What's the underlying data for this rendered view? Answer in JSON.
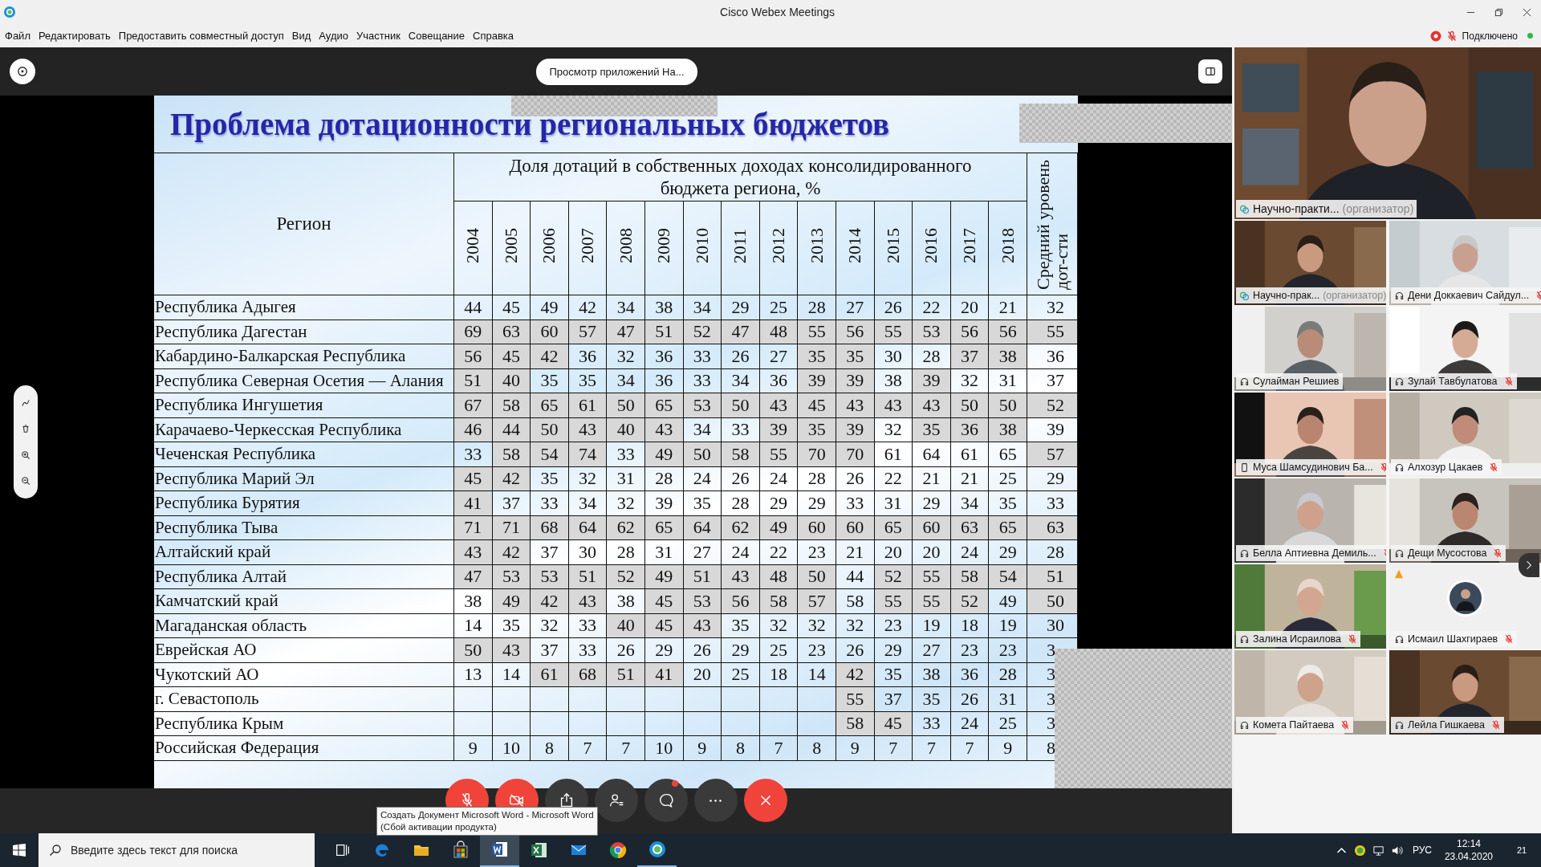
{
  "window": {
    "title": "Cisco Webex Meetings"
  },
  "menu": [
    "Файл",
    "Редактировать",
    "Предоставить совместный доступ",
    "Вид",
    "Аудио",
    "Участник",
    "Совещание",
    "Справка"
  ],
  "connection": {
    "label": "Подключено"
  },
  "share_bar": {
    "label": "Просмотр приложений На..."
  },
  "slide": {
    "title": "Проблема дотационности региональных бюджетов",
    "table": {
      "region_header": "Регион",
      "group_header": "Доля дотаций в собственных доходах консолидированного бюджета региона, %",
      "years": [
        "2004",
        "2005",
        "2006",
        "2007",
        "2008",
        "2009",
        "2010",
        "2011",
        "2012",
        "2013",
        "2014",
        "2015",
        "2016",
        "2017",
        "2018"
      ],
      "average_header": "Средний уровень дот-сти",
      "rows": [
        {
          "region": "Республика Адыгея",
          "cells": [
            {
              "value": "44",
              "shaded": false
            },
            {
              "value": "45",
              "shaded": false
            },
            {
              "value": "49",
              "shaded": false
            },
            {
              "value": "42",
              "shaded": false
            },
            {
              "value": "34",
              "shaded": false
            },
            {
              "value": "38",
              "shaded": false
            },
            {
              "value": "34",
              "shaded": false
            },
            {
              "value": "29",
              "shaded": false
            },
            {
              "value": "25",
              "shaded": false
            },
            {
              "value": "28",
              "shaded": false
            },
            {
              "value": "27",
              "shaded": false
            },
            {
              "value": "26",
              "shaded": false
            },
            {
              "value": "22",
              "shaded": false
            },
            {
              "value": "20",
              "shaded": false
            },
            {
              "value": "21",
              "shaded": false
            },
            {
              "value": "32",
              "shaded": false
            }
          ]
        },
        {
          "region": "Республика Дагестан",
          "cells": [
            {
              "value": "69",
              "shaded": true
            },
            {
              "value": "63",
              "shaded": true
            },
            {
              "value": "60",
              "shaded": true
            },
            {
              "value": "57",
              "shaded": true
            },
            {
              "value": "47",
              "shaded": true
            },
            {
              "value": "51",
              "shaded": true
            },
            {
              "value": "52",
              "shaded": true
            },
            {
              "value": "47",
              "shaded": true
            },
            {
              "value": "48",
              "shaded": true
            },
            {
              "value": "55",
              "shaded": true
            },
            {
              "value": "56",
              "shaded": true
            },
            {
              "value": "55",
              "shaded": true
            },
            {
              "value": "53",
              "shaded": true
            },
            {
              "value": "56",
              "shaded": true
            },
            {
              "value": "56",
              "shaded": true
            },
            {
              "value": "55",
              "shaded": true
            }
          ]
        },
        {
          "region": "Кабардино-Балкарская Республика",
          "cells": [
            {
              "value": "56",
              "shaded": true
            },
            {
              "value": "45",
              "shaded": true
            },
            {
              "value": "42",
              "shaded": true
            },
            {
              "value": "36",
              "shaded": false
            },
            {
              "value": "32",
              "shaded": false
            },
            {
              "value": "36",
              "shaded": false
            },
            {
              "value": "33",
              "shaded": false
            },
            {
              "value": "26",
              "shaded": false
            },
            {
              "value": "27",
              "shaded": false
            },
            {
              "value": "35",
              "shaded": true
            },
            {
              "value": "35",
              "shaded": true
            },
            {
              "value": "30",
              "shaded": false
            },
            {
              "value": "28",
              "shaded": false
            },
            {
              "value": "37",
              "shaded": true
            },
            {
              "value": "38",
              "shaded": true
            },
            {
              "value": "36",
              "shaded": false
            }
          ]
        },
        {
          "region": "Республика Северная Осетия — Алания",
          "cells": [
            {
              "value": "51",
              "shaded": true
            },
            {
              "value": "40",
              "shaded": true
            },
            {
              "value": "35",
              "shaded": false
            },
            {
              "value": "35",
              "shaded": false
            },
            {
              "value": "34",
              "shaded": false
            },
            {
              "value": "36",
              "shaded": false
            },
            {
              "value": "33",
              "shaded": false
            },
            {
              "value": "34",
              "shaded": false
            },
            {
              "value": "36",
              "shaded": false
            },
            {
              "value": "39",
              "shaded": true
            },
            {
              "value": "39",
              "shaded": true
            },
            {
              "value": "38",
              "shaded": false
            },
            {
              "value": "39",
              "shaded": true
            },
            {
              "value": "32",
              "shaded": false
            },
            {
              "value": "31",
              "shaded": false
            },
            {
              "value": "37",
              "shaded": false
            }
          ]
        },
        {
          "region": "Республика Ингушетия",
          "cells": [
            {
              "value": "67",
              "shaded": true
            },
            {
              "value": "58",
              "shaded": true
            },
            {
              "value": "65",
              "shaded": true
            },
            {
              "value": "61",
              "shaded": true
            },
            {
              "value": "50",
              "shaded": true
            },
            {
              "value": "65",
              "shaded": true
            },
            {
              "value": "53",
              "shaded": true
            },
            {
              "value": "50",
              "shaded": true
            },
            {
              "value": "43",
              "shaded": true
            },
            {
              "value": "45",
              "shaded": true
            },
            {
              "value": "43",
              "shaded": true
            },
            {
              "value": "43",
              "shaded": true
            },
            {
              "value": "43",
              "shaded": true
            },
            {
              "value": "50",
              "shaded": true
            },
            {
              "value": "50",
              "shaded": true
            },
            {
              "value": "52",
              "shaded": true
            }
          ]
        },
        {
          "region": "Карачаево-Черкесская Республика",
          "cells": [
            {
              "value": "46",
              "shaded": true
            },
            {
              "value": "44",
              "shaded": true
            },
            {
              "value": "50",
              "shaded": true
            },
            {
              "value": "43",
              "shaded": true
            },
            {
              "value": "40",
              "shaded": true
            },
            {
              "value": "43",
              "shaded": true
            },
            {
              "value": "34",
              "shaded": false
            },
            {
              "value": "33",
              "shaded": false
            },
            {
              "value": "39",
              "shaded": true
            },
            {
              "value": "35",
              "shaded": true
            },
            {
              "value": "39",
              "shaded": true
            },
            {
              "value": "32",
              "shaded": false
            },
            {
              "value": "35",
              "shaded": true
            },
            {
              "value": "36",
              "shaded": true
            },
            {
              "value": "38",
              "shaded": true
            },
            {
              "value": "39",
              "shaded": false
            }
          ]
        },
        {
          "region": "Чеченская Республика",
          "cells": [
            {
              "value": "33",
              "shaded": false
            },
            {
              "value": "58",
              "shaded": true
            },
            {
              "value": "54",
              "shaded": true
            },
            {
              "value": "74",
              "shaded": true
            },
            {
              "value": "33",
              "shaded": false
            },
            {
              "value": "49",
              "shaded": true
            },
            {
              "value": "50",
              "shaded": true
            },
            {
              "value": "58",
              "shaded": true
            },
            {
              "value": "55",
              "shaded": true
            },
            {
              "value": "70",
              "shaded": true
            },
            {
              "value": "70",
              "shaded": true
            },
            {
              "value": "61",
              "shaded": false
            },
            {
              "value": "64",
              "shaded": false
            },
            {
              "value": "61",
              "shaded": false
            },
            {
              "value": "65",
              "shaded": false
            },
            {
              "value": "57",
              "shaded": true
            }
          ]
        },
        {
          "region": "Республика Марий Эл",
          "cells": [
            {
              "value": "45",
              "shaded": true
            },
            {
              "value": "42",
              "shaded": true
            },
            {
              "value": "35",
              "shaded": false
            },
            {
              "value": "32",
              "shaded": false
            },
            {
              "value": "31",
              "shaded": false
            },
            {
              "value": "28",
              "shaded": false
            },
            {
              "value": "24",
              "shaded": false
            },
            {
              "value": "26",
              "shaded": false
            },
            {
              "value": "24",
              "shaded": false
            },
            {
              "value": "28",
              "shaded": false
            },
            {
              "value": "26",
              "shaded": false
            },
            {
              "value": "22",
              "shaded": false
            },
            {
              "value": "21",
              "shaded": false
            },
            {
              "value": "21",
              "shaded": false
            },
            {
              "value": "25",
              "shaded": false
            },
            {
              "value": "29",
              "shaded": false
            }
          ]
        },
        {
          "region": "Республика Бурятия",
          "cells": [
            {
              "value": "41",
              "shaded": true
            },
            {
              "value": "37",
              "shaded": false
            },
            {
              "value": "33",
              "shaded": false
            },
            {
              "value": "34",
              "shaded": false
            },
            {
              "value": "32",
              "shaded": false
            },
            {
              "value": "39",
              "shaded": false
            },
            {
              "value": "35",
              "shaded": false
            },
            {
              "value": "28",
              "shaded": false
            },
            {
              "value": "29",
              "shaded": false
            },
            {
              "value": "29",
              "shaded": false
            },
            {
              "value": "33",
              "shaded": false
            },
            {
              "value": "31",
              "shaded": false
            },
            {
              "value": "29",
              "shaded": false
            },
            {
              "value": "34",
              "shaded": false
            },
            {
              "value": "35",
              "shaded": false
            },
            {
              "value": "33",
              "shaded": false
            }
          ]
        },
        {
          "region": "Республика Тыва",
          "cells": [
            {
              "value": "71",
              "shaded": true
            },
            {
              "value": "71",
              "shaded": true
            },
            {
              "value": "68",
              "shaded": true
            },
            {
              "value": "64",
              "shaded": true
            },
            {
              "value": "62",
              "shaded": true
            },
            {
              "value": "65",
              "shaded": true
            },
            {
              "value": "64",
              "shaded": true
            },
            {
              "value": "62",
              "shaded": true
            },
            {
              "value": "49",
              "shaded": true
            },
            {
              "value": "60",
              "shaded": true
            },
            {
              "value": "60",
              "shaded": true
            },
            {
              "value": "65",
              "shaded": true
            },
            {
              "value": "60",
              "shaded": true
            },
            {
              "value": "63",
              "shaded": true
            },
            {
              "value": "65",
              "shaded": true
            },
            {
              "value": "63",
              "shaded": true
            }
          ]
        },
        {
          "region": "Алтайский край",
          "cells": [
            {
              "value": "43",
              "shaded": true
            },
            {
              "value": "42",
              "shaded": true
            },
            {
              "value": "37",
              "shaded": false
            },
            {
              "value": "30",
              "shaded": false
            },
            {
              "value": "28",
              "shaded": false
            },
            {
              "value": "31",
              "shaded": false
            },
            {
              "value": "27",
              "shaded": false
            },
            {
              "value": "24",
              "shaded": false
            },
            {
              "value": "22",
              "shaded": false
            },
            {
              "value": "23",
              "shaded": false
            },
            {
              "value": "21",
              "shaded": false
            },
            {
              "value": "20",
              "shaded": false
            },
            {
              "value": "20",
              "shaded": false
            },
            {
              "value": "24",
              "shaded": false
            },
            {
              "value": "29",
              "shaded": false
            },
            {
              "value": "28",
              "shaded": false
            }
          ]
        },
        {
          "region": "Республика Алтай",
          "cells": [
            {
              "value": "47",
              "shaded": true
            },
            {
              "value": "53",
              "shaded": true
            },
            {
              "value": "53",
              "shaded": true
            },
            {
              "value": "51",
              "shaded": true
            },
            {
              "value": "52",
              "shaded": true
            },
            {
              "value": "49",
              "shaded": true
            },
            {
              "value": "51",
              "shaded": true
            },
            {
              "value": "43",
              "shaded": true
            },
            {
              "value": "48",
              "shaded": true
            },
            {
              "value": "50",
              "shaded": true
            },
            {
              "value": "44",
              "shaded": false
            },
            {
              "value": "52",
              "shaded": true
            },
            {
              "value": "55",
              "shaded": true
            },
            {
              "value": "58",
              "shaded": true
            },
            {
              "value": "54",
              "shaded": true
            },
            {
              "value": "51",
              "shaded": true
            }
          ]
        },
        {
          "region": "Камчатский край",
          "cells": [
            {
              "value": "38",
              "shaded": false
            },
            {
              "value": "49",
              "shaded": true
            },
            {
              "value": "42",
              "shaded": true
            },
            {
              "value": "43",
              "shaded": true
            },
            {
              "value": "38",
              "shaded": false
            },
            {
              "value": "45",
              "shaded": true
            },
            {
              "value": "53",
              "shaded": true
            },
            {
              "value": "56",
              "shaded": true
            },
            {
              "value": "58",
              "shaded": true
            },
            {
              "value": "57",
              "shaded": true
            },
            {
              "value": "58",
              "shaded": false
            },
            {
              "value": "55",
              "shaded": true
            },
            {
              "value": "55",
              "shaded": true
            },
            {
              "value": "52",
              "shaded": true
            },
            {
              "value": "49",
              "shaded": false
            },
            {
              "value": "50",
              "shaded": true
            }
          ]
        },
        {
          "region": "Магаданская область",
          "cells": [
            {
              "value": "14",
              "shaded": false
            },
            {
              "value": "35",
              "shaded": false
            },
            {
              "value": "32",
              "shaded": false
            },
            {
              "value": "33",
              "shaded": false
            },
            {
              "value": "40",
              "shaded": true
            },
            {
              "value": "45",
              "shaded": true
            },
            {
              "value": "43",
              "shaded": true
            },
            {
              "value": "35",
              "shaded": false
            },
            {
              "value": "32",
              "shaded": false
            },
            {
              "value": "32",
              "shaded": false
            },
            {
              "value": "32",
              "shaded": false
            },
            {
              "value": "23",
              "shaded": false
            },
            {
              "value": "19",
              "shaded": false
            },
            {
              "value": "18",
              "shaded": false
            },
            {
              "value": "19",
              "shaded": false
            },
            {
              "value": "30",
              "shaded": false
            }
          ]
        },
        {
          "region": "Еврейская АО",
          "cells": [
            {
              "value": "50",
              "shaded": true
            },
            {
              "value": "43",
              "shaded": true
            },
            {
              "value": "37",
              "shaded": false
            },
            {
              "value": "33",
              "shaded": false
            },
            {
              "value": "26",
              "shaded": false
            },
            {
              "value": "29",
              "shaded": false
            },
            {
              "value": "26",
              "shaded": false
            },
            {
              "value": "29",
              "shaded": false
            },
            {
              "value": "25",
              "shaded": false
            },
            {
              "value": "23",
              "shaded": false
            },
            {
              "value": "26",
              "shaded": false
            },
            {
              "value": "29",
              "shaded": false
            },
            {
              "value": "27",
              "shaded": false
            },
            {
              "value": "23",
              "shaded": false
            },
            {
              "value": "23",
              "shaded": false
            },
            {
              "value": "3",
              "shaded": false
            }
          ]
        },
        {
          "region": "Чукотский АО",
          "cells": [
            {
              "value": "13",
              "shaded": false
            },
            {
              "value": "14",
              "shaded": false
            },
            {
              "value": "61",
              "shaded": true
            },
            {
              "value": "68",
              "shaded": true
            },
            {
              "value": "51",
              "shaded": true
            },
            {
              "value": "41",
              "shaded": true
            },
            {
              "value": "20",
              "shaded": false
            },
            {
              "value": "25",
              "shaded": false
            },
            {
              "value": "18",
              "shaded": false
            },
            {
              "value": "14",
              "shaded": false
            },
            {
              "value": "42",
              "shaded": true
            },
            {
              "value": "35",
              "shaded": false
            },
            {
              "value": "38",
              "shaded": false
            },
            {
              "value": "36",
              "shaded": false
            },
            {
              "value": "28",
              "shaded": false
            },
            {
              "value": "3",
              "shaded": false
            }
          ]
        },
        {
          "region": "г. Севастополь",
          "cells": [
            {
              "shaded": false
            },
            {
              "shaded": false
            },
            {
              "shaded": false
            },
            {
              "shaded": false
            },
            {
              "shaded": false
            },
            {
              "shaded": false
            },
            {
              "shaded": false
            },
            {
              "shaded": false
            },
            {
              "shaded": false
            },
            {
              "shaded": false
            },
            {
              "value": "55",
              "shaded": true
            },
            {
              "value": "37",
              "shaded": false
            },
            {
              "value": "35",
              "shaded": false
            },
            {
              "value": "26",
              "shaded": false
            },
            {
              "value": "31",
              "shaded": false
            },
            {
              "value": "3",
              "shaded": false
            }
          ]
        },
        {
          "region": "Республика Крым",
          "cells": [
            {
              "shaded": false
            },
            {
              "shaded": false
            },
            {
              "shaded": false
            },
            {
              "shaded": false
            },
            {
              "shaded": false
            },
            {
              "shaded": false
            },
            {
              "shaded": false
            },
            {
              "shaded": false
            },
            {
              "shaded": false
            },
            {
              "shaded": false
            },
            {
              "value": "58",
              "shaded": true
            },
            {
              "value": "45",
              "shaded": true
            },
            {
              "value": "33",
              "shaded": false
            },
            {
              "value": "24",
              "shaded": false
            },
            {
              "value": "25",
              "shaded": false
            },
            {
              "value": "3",
              "shaded": false
            }
          ]
        },
        {
          "region": "Российская Федерация",
          "cells": [
            {
              "value": "9",
              "shaded": false
            },
            {
              "value": "10",
              "shaded": false
            },
            {
              "value": "8",
              "shaded": false
            },
            {
              "value": "7",
              "shaded": false
            },
            {
              "value": "7",
              "shaded": false
            },
            {
              "value": "10",
              "shaded": false
            },
            {
              "value": "9",
              "shaded": false
            },
            {
              "value": "8",
              "shaded": false
            },
            {
              "value": "7",
              "shaded": false
            },
            {
              "value": "8",
              "shaded": false
            },
            {
              "value": "9",
              "shaded": false
            },
            {
              "value": "7",
              "shaded": false
            },
            {
              "value": "7",
              "shaded": false
            },
            {
              "value": "7",
              "shaded": false
            },
            {
              "value": "9",
              "shaded": false
            },
            {
              "value": "8",
              "shaded": false
            }
          ]
        }
      ]
    }
  },
  "participants": {
    "main": {
      "name": "Научно-практи...",
      "role": "(организатор)",
      "kind": "host"
    },
    "tiles": [
      {
        "name": "Научно-прак...",
        "role": "(организатор)",
        "kind": "host",
        "muted": false,
        "video": true
      },
      {
        "name": "Дени Доккаевич Сайдул...",
        "kind": "headset",
        "muted": true,
        "video": true
      },
      {
        "name": "Сулайман Решиев",
        "kind": "headset",
        "muted": false,
        "video": true
      },
      {
        "name": "Зулай Тавбулатова",
        "kind": "headset",
        "muted": true,
        "video": true
      },
      {
        "name": "Муса Шамсудинович Ба...",
        "kind": "phone",
        "muted": true,
        "video": true
      },
      {
        "name": "Алхозур Цакаев",
        "kind": "headset",
        "muted": true,
        "video": true
      },
      {
        "name": "Белла Аптиевна Демиль...",
        "kind": "headset",
        "muted": true,
        "video": true
      },
      {
        "name": "Дещи Мусостова",
        "kind": "headset",
        "muted": true,
        "video": true
      },
      {
        "name": "Залина Исраилова",
        "kind": "headset",
        "muted": true,
        "video": true
      },
      {
        "name": "Исмаил Шахгираев",
        "kind": "headset",
        "muted": true,
        "video": false,
        "warning": true
      },
      {
        "name": "Комета Пайтаева",
        "kind": "headset",
        "muted": true,
        "video": true
      },
      {
        "name": "Лейла Гишкаева",
        "kind": "headset",
        "muted": true,
        "video": true
      }
    ]
  },
  "controls": [
    {
      "kind": "mute",
      "active": true
    },
    {
      "kind": "video",
      "active": true
    },
    {
      "kind": "share",
      "active": false
    },
    {
      "kind": "participants",
      "active": false
    },
    {
      "kind": "chat",
      "active": false,
      "badge": true
    },
    {
      "kind": "more",
      "active": false
    },
    {
      "kind": "leave",
      "active": true
    }
  ],
  "tooltip": [
    "Создать Документ Microsoft Word - Microsoft Word",
    "(Сбой активации продукта)"
  ],
  "taskbar": {
    "search_placeholder": "Введите здесь текст для поиска",
    "apps": [
      {
        "kind": "task-view",
        "selected": false,
        "running": false
      },
      {
        "kind": "browser",
        "selected": false,
        "running": false
      },
      {
        "kind": "folder",
        "selected": false,
        "running": false
      },
      {
        "kind": "store",
        "selected": false,
        "running": false
      },
      {
        "kind": "word",
        "selected": true,
        "running": true
      },
      {
        "kind": "excel",
        "selected": false,
        "running": false
      },
      {
        "kind": "mail",
        "selected": false,
        "running": false
      },
      {
        "kind": "chrome",
        "selected": false,
        "running": false
      },
      {
        "kind": "webex",
        "selected": false,
        "running": true
      }
    ],
    "language": "РУС",
    "time": "12:14",
    "date": "23.04.2020",
    "notifications": "21"
  }
}
